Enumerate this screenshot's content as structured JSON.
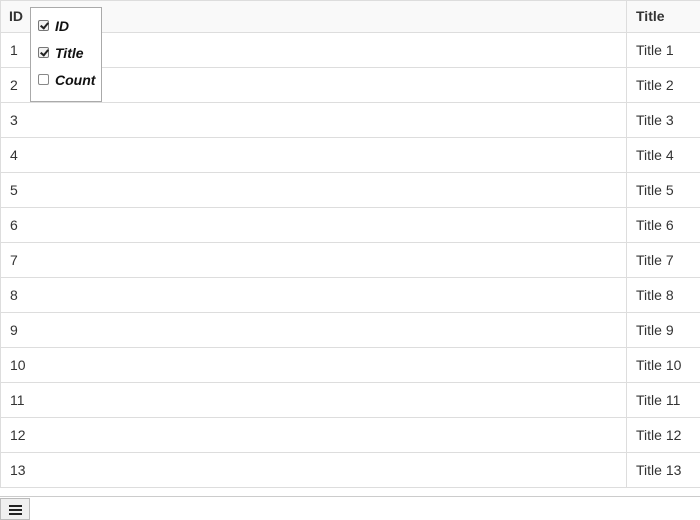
{
  "grid": {
    "columns": [
      {
        "key": "id",
        "label": "ID"
      },
      {
        "key": "title",
        "label": "Title"
      }
    ],
    "rows": [
      {
        "id": "1",
        "title": "Title 1"
      },
      {
        "id": "2",
        "title": "Title 2"
      },
      {
        "id": "3",
        "title": "Title 3"
      },
      {
        "id": "4",
        "title": "Title 4"
      },
      {
        "id": "5",
        "title": "Title 5"
      },
      {
        "id": "6",
        "title": "Title 6"
      },
      {
        "id": "7",
        "title": "Title 7"
      },
      {
        "id": "8",
        "title": "Title 8"
      },
      {
        "id": "9",
        "title": "Title 9"
      },
      {
        "id": "10",
        "title": "Title 10"
      },
      {
        "id": "11",
        "title": "Title 11"
      },
      {
        "id": "12",
        "title": "Title 12"
      },
      {
        "id": "13",
        "title": "Title 13"
      }
    ]
  },
  "column_picker": {
    "options": [
      {
        "label": "ID",
        "checked": true
      },
      {
        "label": "Title",
        "checked": true
      },
      {
        "label": "Count",
        "checked": false
      }
    ]
  },
  "footer": {
    "menu_icon": "hamburger-menu-icon"
  },
  "colors": {
    "border": "#dddddd",
    "header_background": "#f9f9f9",
    "text": "#333333"
  }
}
